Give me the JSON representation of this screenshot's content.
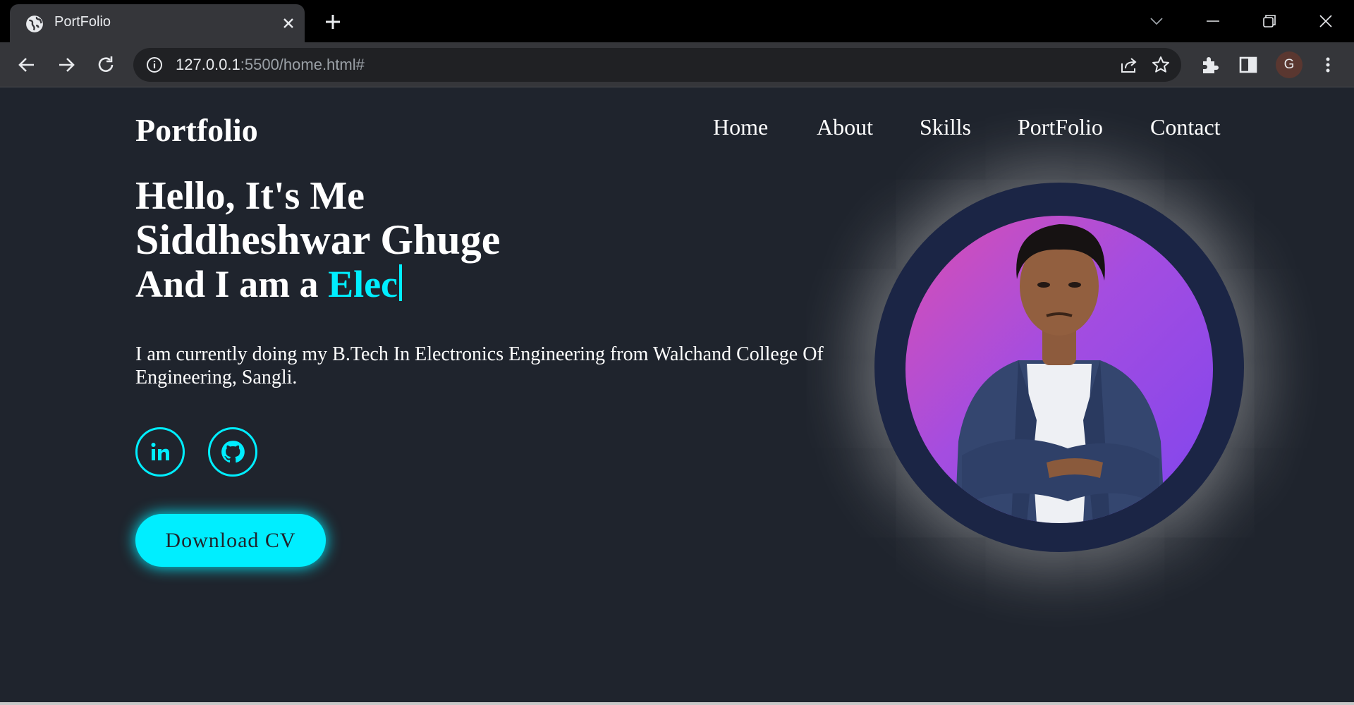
{
  "browser": {
    "tab_title": "PortFolio",
    "url_host": "127.0.0.1",
    "url_rest": ":5500/home.html#",
    "avatar_letter": "G"
  },
  "header": {
    "logo": "Portfolio",
    "nav": [
      "Home",
      "About",
      "Skills",
      "PortFolio",
      "Contact"
    ]
  },
  "hero": {
    "line1": "Hello, It's Me",
    "line2": "Siddheshwar Ghuge",
    "line3_prefix": "And I am a ",
    "line3_typed": "Elec",
    "description": "I am currently doing my B.Tech In Electronics Engineering from Walchand College Of Engineering, Sangli.",
    "social": [
      "linkedin-icon",
      "github-icon"
    ],
    "cv_button": "Download CV"
  },
  "colors": {
    "background": "#1f242d",
    "accent": "#00eeff",
    "ring": "#1b2545"
  }
}
